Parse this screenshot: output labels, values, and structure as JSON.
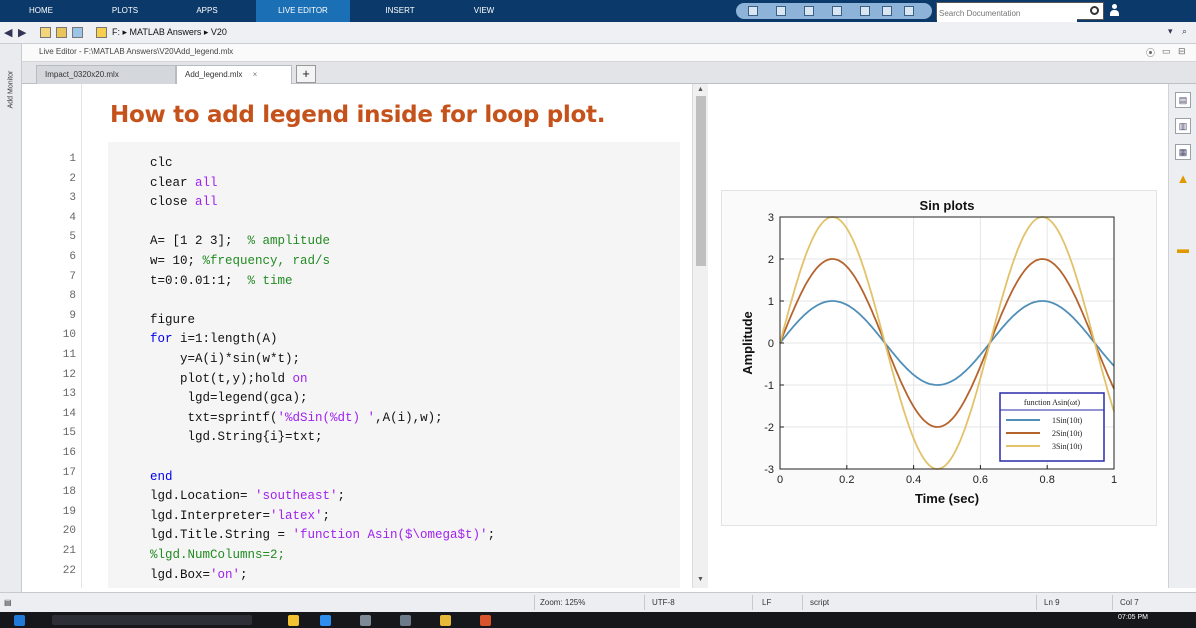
{
  "ribbon": {
    "tabs": [
      {
        "label": "HOME"
      },
      {
        "label": "PLOTS"
      },
      {
        "label": "APPS"
      },
      {
        "label": "LIVE EDITOR"
      },
      {
        "label": "INSERT"
      },
      {
        "label": "VIEW"
      }
    ],
    "active_tab": "LIVE EDITOR",
    "search_placeholder": "Search Documentation"
  },
  "address_bar": {
    "path": "F: ▸ MATLAB Answers ▸ V20"
  },
  "editor": {
    "title": "Live Editor - F:\\MATLAB Answers\\V20\\Add_legend.mlx",
    "tabs": [
      {
        "label": "Impact_0320x20.mlx",
        "active": false
      },
      {
        "label": "Add_legend.mlx",
        "active": true
      }
    ],
    "side_label": "Add Monitor",
    "doc_title": "How to add legend inside for loop plot.",
    "line_numbers": [
      "1",
      "2",
      "3",
      "4",
      "5",
      "6",
      "7",
      "8",
      "9",
      "10",
      "11",
      "12",
      "13",
      "14",
      "15",
      "16",
      "17",
      "18",
      "19",
      "20",
      "21",
      "22"
    ],
    "code_lines": [
      "clc",
      "clear all",
      "close all",
      "",
      "A= [1 2 3];  % amplitude",
      "w= 10; %frequency, rad/s",
      "t=0:0.01:1;  % time",
      "",
      "figure",
      "for i=1:length(A)",
      "    y=A(i)*sin(w*t);",
      "    plot(t,y);hold on",
      "     lgd=legend(gca);",
      "     txt=sprintf('%dSin(%dt) ',A(i),w);",
      "     lgd.String{i}=txt;",
      "",
      "end",
      "lgd.Location= 'southeast';",
      "lgd.Interpreter='latex';",
      "lgd.Title.String = 'function Asin($\\omega$t)';",
      "%lgd.NumColumns=2;",
      "lgd.Box='on';"
    ]
  },
  "colors": {
    "ribbon_bg": "#0b3a6a",
    "ribbon_active": "#1a6fb5",
    "title_orange": "#c5521a",
    "keyword_blue": "#0000ee",
    "string_purple": "#a020f0",
    "comment_green": "#228b22",
    "series1": "#4f8fb8",
    "series2": "#b5642e",
    "series3": "#e2c26a"
  },
  "chart_data": {
    "type": "line",
    "title": "Sin plots",
    "xlabel": "Time (sec)",
    "ylabel": "Amplitude",
    "xlim": [
      0,
      1
    ],
    "ylim": [
      -3,
      3
    ],
    "xticks": [
      "0",
      "0.2",
      "0.4",
      "0.6",
      "0.8",
      "1"
    ],
    "yticks": [
      "3",
      "2",
      "1",
      "0",
      "-1",
      "-2",
      "-3"
    ],
    "grid": true,
    "legend_location": "southeast",
    "legend_title": "function Asin(ωt)",
    "series": [
      {
        "name": "1Sin(10t)",
        "amplitude": 1,
        "omega": 10
      },
      {
        "name": "2Sin(10t)",
        "amplitude": 2,
        "omega": 10
      },
      {
        "name": "3Sin(10t)",
        "amplitude": 3,
        "omega": 10
      }
    ]
  },
  "status_bar": {
    "zoom": "Zoom: 125%",
    "encoding": "UTF-8",
    "eol": "LF",
    "mode": "script",
    "line": "Ln  9",
    "col": "Col  7"
  },
  "taskbar": {
    "clock": "07:05 PM"
  }
}
